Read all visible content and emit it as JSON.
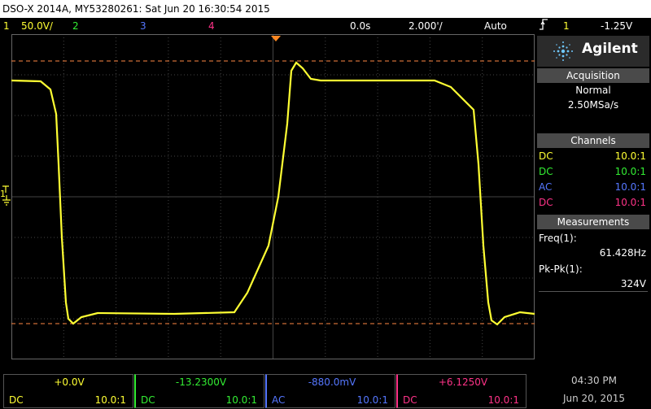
{
  "title": "DSO-X 2014A, MY53280261: Sat Jun 20 16:30:54 2015",
  "channels_bar": {
    "ch1_num": "1",
    "ch1_scale": "50.0V/",
    "ch2_num": "2",
    "ch3_num": "3",
    "ch4_num": "4",
    "time_delay": "0.0s",
    "time_scale": "2.000'/",
    "trigger_mode": "Auto",
    "trigger_icon": "trigger-edge-icon",
    "trigger_ch": "1",
    "trigger_level": "-1.25V"
  },
  "colors": {
    "ch1": "#ffff33",
    "ch2": "#33ee33",
    "ch3": "#5577ff",
    "ch4": "#ff3388",
    "ref": "#ff8844"
  },
  "sidebar": {
    "brand": "Agilent",
    "acquisition_header": "Acquisition",
    "acq_mode": "Normal",
    "acq_rate": "2.50MSa/s",
    "channels_header": "Channels",
    "channels": [
      {
        "coupling": "DC",
        "probe": "10.0:1"
      },
      {
        "coupling": "DC",
        "probe": "10.0:1"
      },
      {
        "coupling": "AC",
        "probe": "10.0:1"
      },
      {
        "coupling": "DC",
        "probe": "10.0:1"
      }
    ],
    "measurements_header": "Measurements",
    "meas1_label": "Freq(1):",
    "meas1_value": "61.428Hz",
    "meas2_label": "Pk-Pk(1):",
    "meas2_value": "324V"
  },
  "bottom": [
    {
      "offset": "+0.0V",
      "coupling": "DC",
      "probe": "10.0:1"
    },
    {
      "offset": "-13.2300V",
      "coupling": "DC",
      "probe": "10.0:1"
    },
    {
      "offset": "-880.0mV",
      "coupling": "AC",
      "probe": "10.0:1"
    },
    {
      "offset": "+6.1250V",
      "coupling": "DC",
      "probe": "10.0:1"
    }
  ],
  "clock": {
    "time": "04:30 PM",
    "date": "Jun 20, 2015"
  },
  "ground_marker": "1"
}
